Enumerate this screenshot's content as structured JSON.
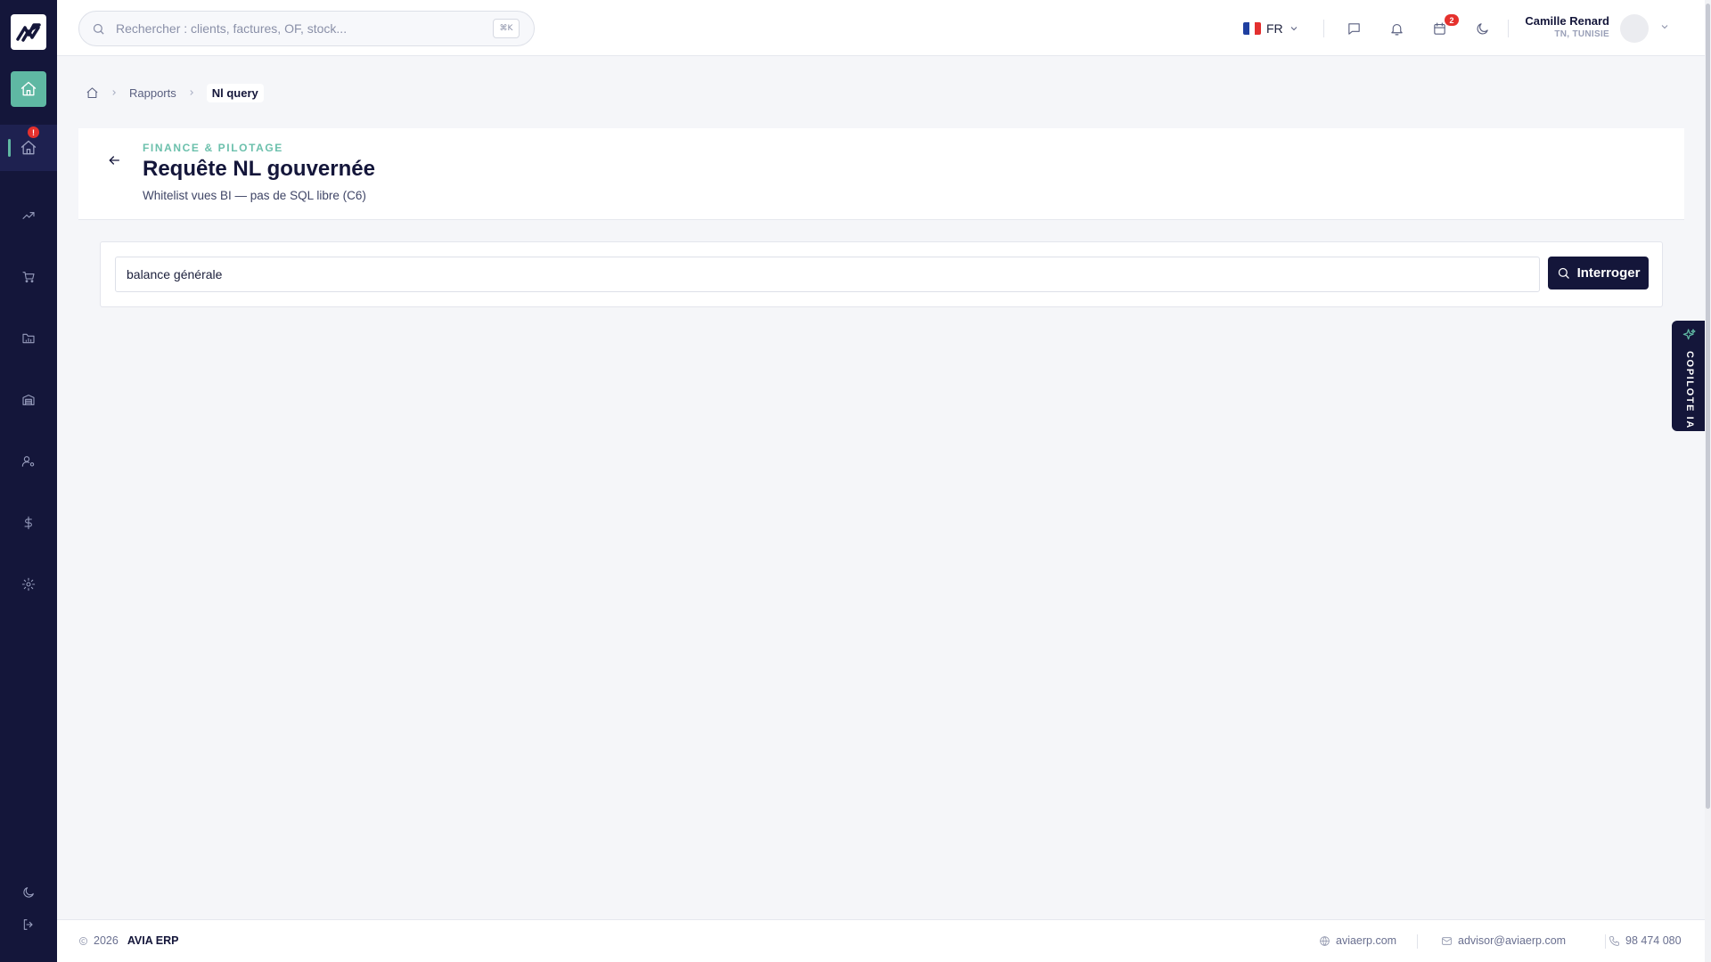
{
  "sidebar": {
    "alert_count": "!",
    "items": [
      {
        "name": "home",
        "icon": "home-icon"
      },
      {
        "name": "home-alert",
        "icon": "home-icon"
      },
      {
        "name": "trends",
        "icon": "trend-up-icon"
      },
      {
        "name": "sales",
        "icon": "cart-icon"
      },
      {
        "name": "files",
        "icon": "folder-icon"
      },
      {
        "name": "warehouse",
        "icon": "warehouse-icon"
      },
      {
        "name": "users",
        "icon": "user-settings-icon"
      },
      {
        "name": "finance",
        "icon": "dollar-icon"
      },
      {
        "name": "settings",
        "icon": "gear-icon"
      }
    ],
    "bottom": [
      {
        "name": "theme",
        "icon": "moon-icon"
      },
      {
        "name": "logout",
        "icon": "logout-icon"
      }
    ]
  },
  "topbar": {
    "search_placeholder": "Rechercher : clients, factures, OF, stock...",
    "search_shortcut": "⌘K",
    "language": "FR",
    "notification_count": "2",
    "user_name": "Camille Renard",
    "user_location": "TN, TUNISIE"
  },
  "breadcrumb": {
    "parent": "Rapports",
    "current": "Nl query"
  },
  "page": {
    "eyebrow": "FINANCE & PILOTAGE",
    "title": "Requête NL gouvernée",
    "subtitle": "Whitelist vues BI — pas de SQL libre (C6)"
  },
  "query": {
    "value": "balance générale",
    "button_label": "Interroger"
  },
  "copilot": {
    "label": "COPILOTE IA"
  },
  "footer": {
    "year": "2026",
    "brand": "AVIA ERP",
    "website": "aviaerp.com",
    "email": "advisor@aviaerp.com",
    "phone": "98 474 080"
  },
  "colors": {
    "sidebar": "#14163a",
    "accent": "#5fb8a3",
    "primary_button": "#14163a",
    "badge": "#e5312d"
  }
}
